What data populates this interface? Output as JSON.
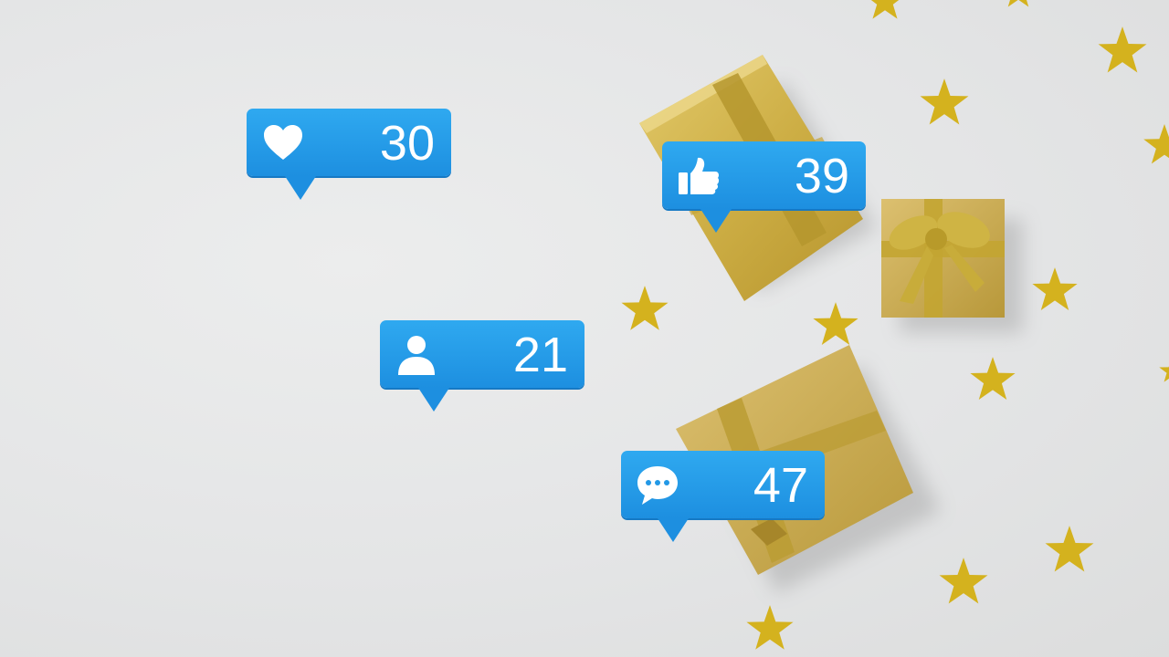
{
  "notifications": [
    {
      "icon": "heart-icon",
      "count": "30"
    },
    {
      "icon": "thumbs-up-icon",
      "count": "39"
    },
    {
      "icon": "user-icon",
      "count": "21"
    },
    {
      "icon": "comment-icon",
      "count": "47"
    }
  ],
  "colors": {
    "bubble": "#1d8fe0",
    "bubble_light": "#2fa9f0",
    "gift_gold": "#c9a83c",
    "star_gold": "#d6b21c",
    "background": "#e5e6e6"
  }
}
